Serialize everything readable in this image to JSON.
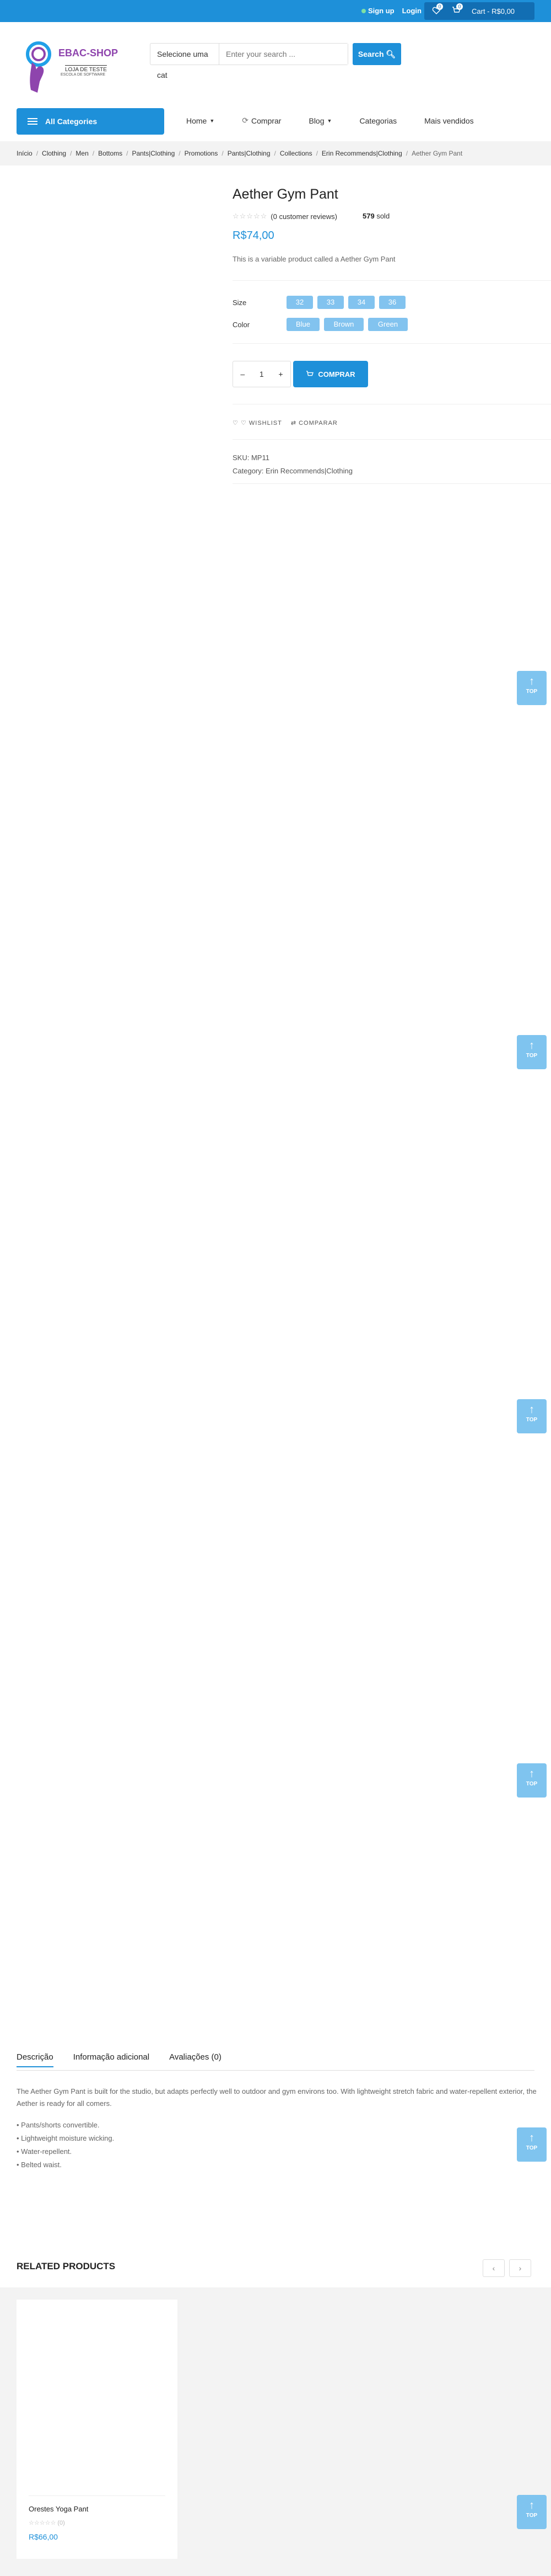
{
  "topbar": {
    "signup": "Sign up",
    "login": "Login",
    "cart_label": "Cart - R$0,00",
    "wishlist_count": "0",
    "cart_count": "0"
  },
  "logo": {
    "brand": "EBAC-SHOP",
    "tagline": "LOJA DE TESTE",
    "subtagline": "ESCOLA DE SOFTWARE"
  },
  "search": {
    "category": "Selecione uma cat",
    "placeholder": "Enter your search ...",
    "button": "Search"
  },
  "nav": {
    "all_categories": "All Categories",
    "items": [
      {
        "label": "Home",
        "caret": true
      },
      {
        "label": "Comprar",
        "caret": false
      },
      {
        "label": "Blog",
        "caret": true
      },
      {
        "label": "Categorias",
        "caret": false
      },
      {
        "label": "Mais vendidos",
        "caret": false
      }
    ]
  },
  "breadcrumb": [
    "Início",
    "Clothing",
    "Men",
    "Bottoms",
    "Pants|Clothing",
    "Promotions",
    "Pants|Clothing",
    "Collections",
    "Erin Recommends|Clothing",
    "Aether Gym Pant"
  ],
  "product": {
    "title": "Aether Gym Pant",
    "reviews": "(0 customer reviews)",
    "sold_count": "579",
    "sold_label": "sold",
    "price": "R$74,00",
    "short_description": "This is a variable product called a Aether Gym Pant",
    "size_label": "Size",
    "sizes": [
      "32",
      "33",
      "34",
      "36"
    ],
    "color_label": "Color",
    "colors": [
      "Blue",
      "Brown",
      "Green"
    ],
    "quantity": "1",
    "buy_button": "COMPRAR",
    "wishlist": "WISHLIST",
    "compare": "COMPARAR",
    "sku_label": "SKU:",
    "sku": "MP11",
    "category_label": "Category:",
    "category": "Erin Recommends|Clothing"
  },
  "back_to_top": "TOP",
  "tabs": {
    "items": [
      "Descrição",
      "Informação adicional",
      "Avaliações (0)"
    ],
    "description": "The Aether Gym Pant is built for the studio, but adapts perfectly well to outdoor and gym environs too. With lightweight stretch fabric and water-repellent exterior, the Aether is ready for all comers.",
    "features": [
      "• Pants/shorts convertible.",
      "• Lightweight moisture wicking.",
      "• Water-repellent.",
      "• Belted waist."
    ]
  },
  "related": {
    "heading": "RELATED PRODUCTS",
    "prev": "‹",
    "next": "›",
    "products": [
      {
        "name": "Orestes Yoga Pant",
        "rating_count": "(0)",
        "price": "R$66,00"
      }
    ]
  }
}
